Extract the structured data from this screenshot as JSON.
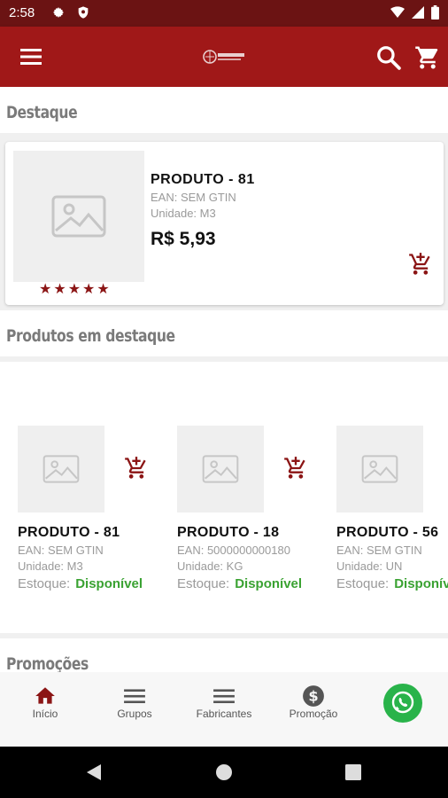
{
  "status_bar": {
    "time": "2:58"
  },
  "app_bar": {
    "logo_text": "GLOBAL"
  },
  "sections": {
    "highlight": "Destaque",
    "featured_products": "Produtos em destaque",
    "promotions": "Promoções"
  },
  "featured": {
    "name": "PRODUTO - 81",
    "ean": "EAN: SEM GTIN",
    "unit": "Unidade: M3",
    "price": "R$ 5,93",
    "rating": "★★★★★"
  },
  "products": [
    {
      "name": "PRODUTO - 81",
      "ean": "EAN: SEM GTIN",
      "unit": "Unidade: M3",
      "stock_label": "Estoque:",
      "stock_value": "Disponível"
    },
    {
      "name": "PRODUTO - 18",
      "ean": "EAN: 5000000000180",
      "unit": "Unidade: KG",
      "stock_label": "Estoque:",
      "stock_value": "Disponível"
    },
    {
      "name": "PRODUTO - 56",
      "ean": "EAN: SEM GTIN",
      "unit": "Unidade: UN",
      "stock_label": "Estoque:",
      "stock_value": "Disponível"
    }
  ],
  "bottom_nav": [
    {
      "label": "Início",
      "icon": "home-icon"
    },
    {
      "label": "Grupos",
      "icon": "list-icon"
    },
    {
      "label": "Fabricantes",
      "icon": "list-icon"
    },
    {
      "label": "Promoção",
      "icon": "dollar-icon"
    }
  ],
  "colors": {
    "status_bar": "#6b1313",
    "app_bar": "#a01818",
    "accent": "#8b1515",
    "available": "#3aa232",
    "whatsapp": "#29b34a"
  }
}
